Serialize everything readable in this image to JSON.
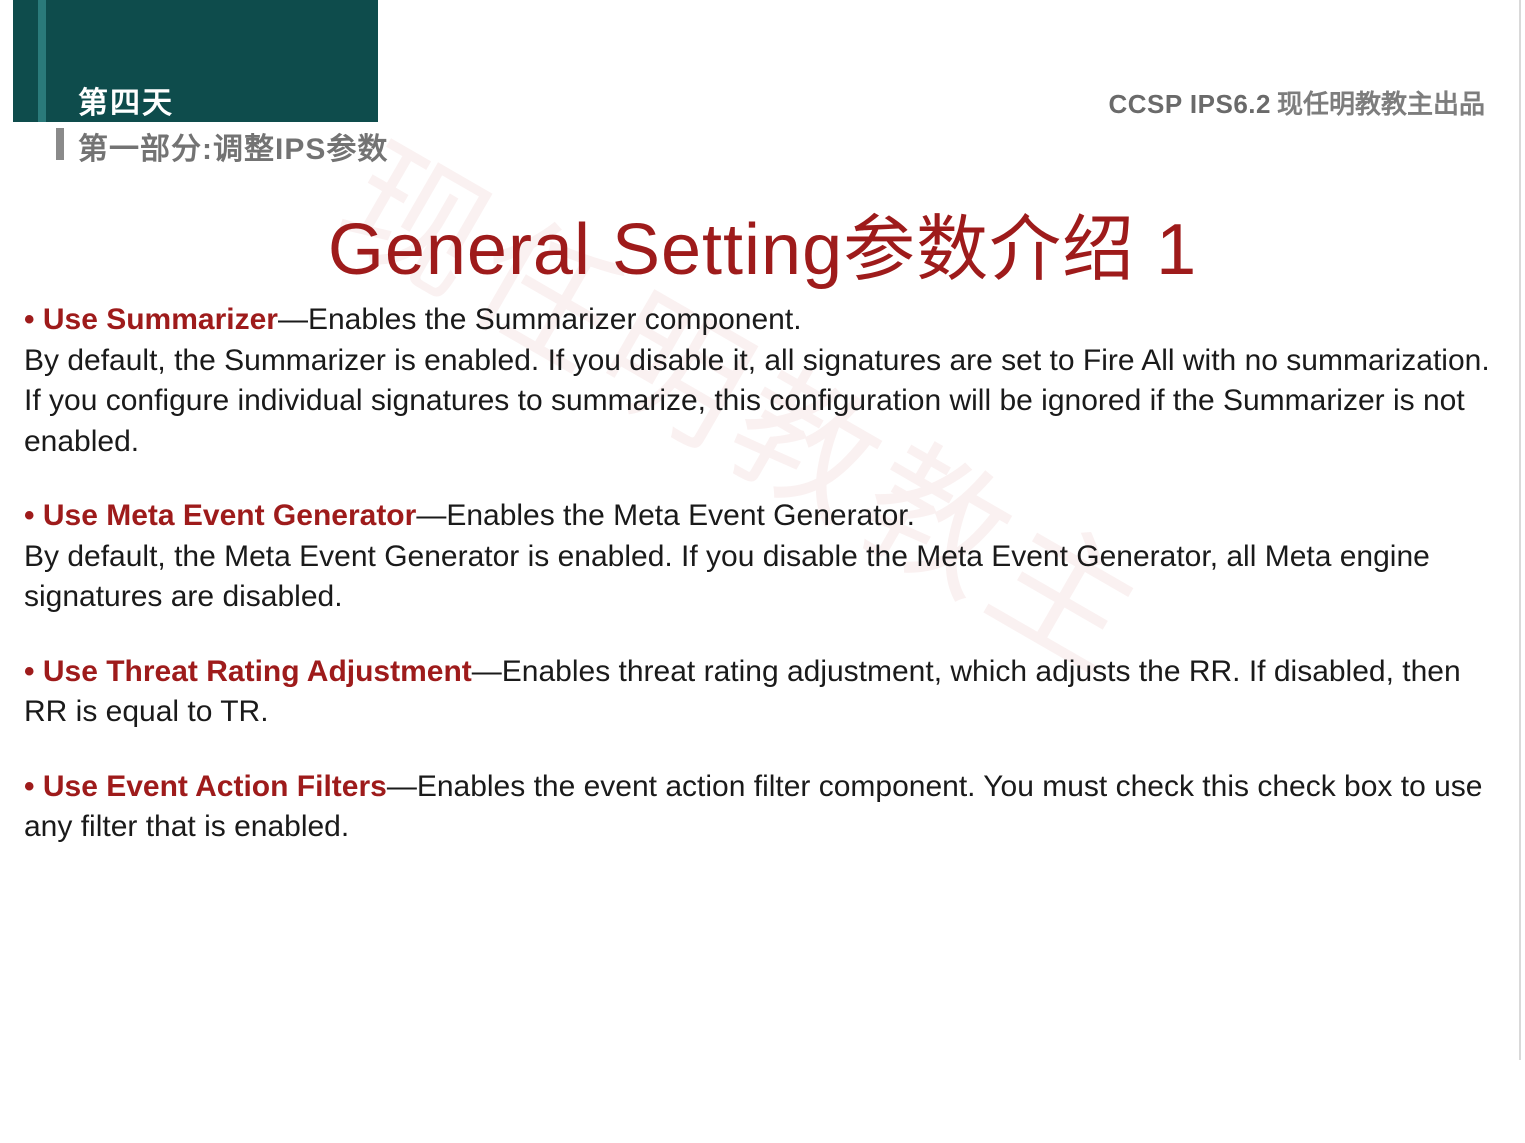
{
  "header": {
    "day": "第四天",
    "part": "第一部分:调整IPS参数",
    "course_code": "CCSP IPS6.2",
    "course_tail": "现任明教教主出品"
  },
  "title": "General Setting参数介绍 1",
  "watermark": "现任明教教主",
  "items": [
    {
      "lead": "Use Summarizer",
      "lead_tail": "—Enables the Summarizer component.",
      "body": "By default, the Summarizer is enabled. If you disable it, all signatures are set to Fire All with no summarization. If you configure individual signatures to summarize, this configuration will be ignored if the Summarizer is not enabled."
    },
    {
      "lead": "Use Meta Event Generator",
      "lead_tail": "—Enables the Meta Event Generator.",
      "body": "By default, the Meta Event Generator is enabled. If you disable the Meta Event Generator, all Meta engine signatures are disabled."
    },
    {
      "lead": "Use Threat Rating Adjustment",
      "lead_tail": "—Enables threat rating adjustment, which adjusts the RR. If disabled, then RR is equal to TR.",
      "body": ""
    },
    {
      "lead": "Use Event Action Filters",
      "lead_tail": "—Enables the event action filter component. You must check this check box to use any filter that is enabled.",
      "body": ""
    }
  ]
}
